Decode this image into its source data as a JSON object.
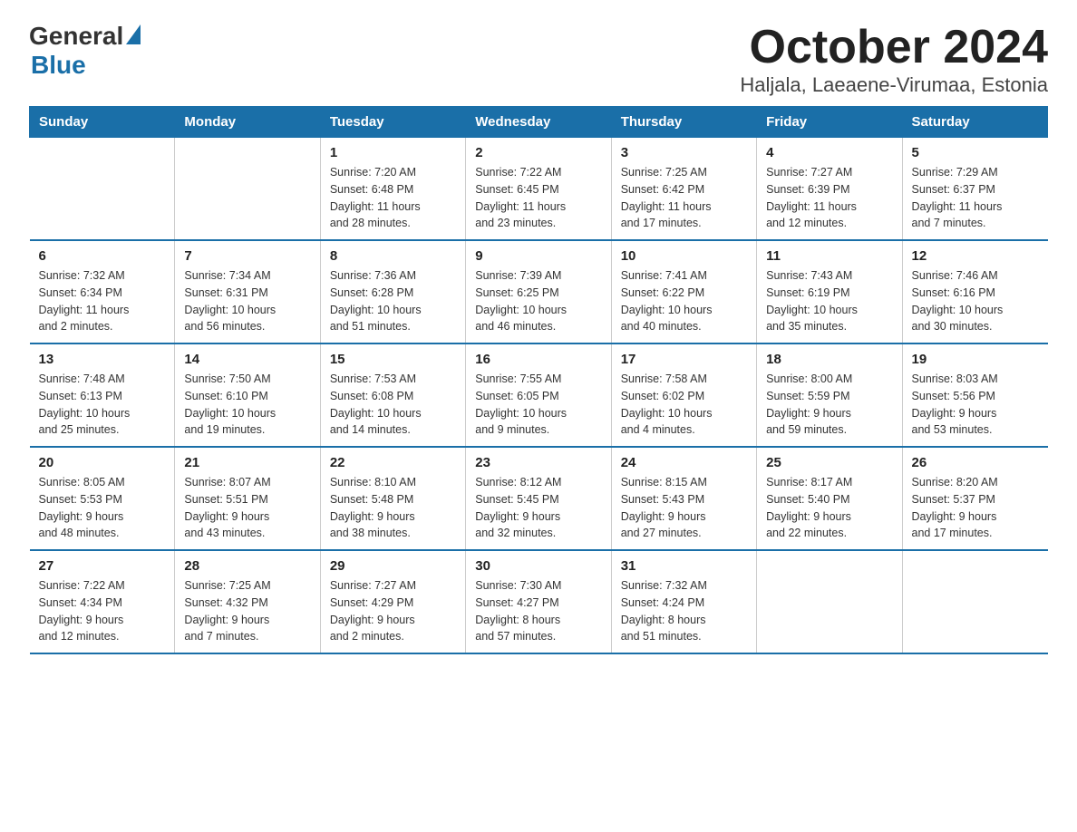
{
  "header": {
    "title": "October 2024",
    "subtitle": "Haljala, Laeaene-Virumaa, Estonia",
    "logo_general": "General",
    "logo_blue": "Blue"
  },
  "weekdays": [
    "Sunday",
    "Monday",
    "Tuesday",
    "Wednesday",
    "Thursday",
    "Friday",
    "Saturday"
  ],
  "weeks": [
    [
      {
        "day": "",
        "info": ""
      },
      {
        "day": "",
        "info": ""
      },
      {
        "day": "1",
        "info": "Sunrise: 7:20 AM\nSunset: 6:48 PM\nDaylight: 11 hours\nand 28 minutes."
      },
      {
        "day": "2",
        "info": "Sunrise: 7:22 AM\nSunset: 6:45 PM\nDaylight: 11 hours\nand 23 minutes."
      },
      {
        "day": "3",
        "info": "Sunrise: 7:25 AM\nSunset: 6:42 PM\nDaylight: 11 hours\nand 17 minutes."
      },
      {
        "day": "4",
        "info": "Sunrise: 7:27 AM\nSunset: 6:39 PM\nDaylight: 11 hours\nand 12 minutes."
      },
      {
        "day": "5",
        "info": "Sunrise: 7:29 AM\nSunset: 6:37 PM\nDaylight: 11 hours\nand 7 minutes."
      }
    ],
    [
      {
        "day": "6",
        "info": "Sunrise: 7:32 AM\nSunset: 6:34 PM\nDaylight: 11 hours\nand 2 minutes."
      },
      {
        "day": "7",
        "info": "Sunrise: 7:34 AM\nSunset: 6:31 PM\nDaylight: 10 hours\nand 56 minutes."
      },
      {
        "day": "8",
        "info": "Sunrise: 7:36 AM\nSunset: 6:28 PM\nDaylight: 10 hours\nand 51 minutes."
      },
      {
        "day": "9",
        "info": "Sunrise: 7:39 AM\nSunset: 6:25 PM\nDaylight: 10 hours\nand 46 minutes."
      },
      {
        "day": "10",
        "info": "Sunrise: 7:41 AM\nSunset: 6:22 PM\nDaylight: 10 hours\nand 40 minutes."
      },
      {
        "day": "11",
        "info": "Sunrise: 7:43 AM\nSunset: 6:19 PM\nDaylight: 10 hours\nand 35 minutes."
      },
      {
        "day": "12",
        "info": "Sunrise: 7:46 AM\nSunset: 6:16 PM\nDaylight: 10 hours\nand 30 minutes."
      }
    ],
    [
      {
        "day": "13",
        "info": "Sunrise: 7:48 AM\nSunset: 6:13 PM\nDaylight: 10 hours\nand 25 minutes."
      },
      {
        "day": "14",
        "info": "Sunrise: 7:50 AM\nSunset: 6:10 PM\nDaylight: 10 hours\nand 19 minutes."
      },
      {
        "day": "15",
        "info": "Sunrise: 7:53 AM\nSunset: 6:08 PM\nDaylight: 10 hours\nand 14 minutes."
      },
      {
        "day": "16",
        "info": "Sunrise: 7:55 AM\nSunset: 6:05 PM\nDaylight: 10 hours\nand 9 minutes."
      },
      {
        "day": "17",
        "info": "Sunrise: 7:58 AM\nSunset: 6:02 PM\nDaylight: 10 hours\nand 4 minutes."
      },
      {
        "day": "18",
        "info": "Sunrise: 8:00 AM\nSunset: 5:59 PM\nDaylight: 9 hours\nand 59 minutes."
      },
      {
        "day": "19",
        "info": "Sunrise: 8:03 AM\nSunset: 5:56 PM\nDaylight: 9 hours\nand 53 minutes."
      }
    ],
    [
      {
        "day": "20",
        "info": "Sunrise: 8:05 AM\nSunset: 5:53 PM\nDaylight: 9 hours\nand 48 minutes."
      },
      {
        "day": "21",
        "info": "Sunrise: 8:07 AM\nSunset: 5:51 PM\nDaylight: 9 hours\nand 43 minutes."
      },
      {
        "day": "22",
        "info": "Sunrise: 8:10 AM\nSunset: 5:48 PM\nDaylight: 9 hours\nand 38 minutes."
      },
      {
        "day": "23",
        "info": "Sunrise: 8:12 AM\nSunset: 5:45 PM\nDaylight: 9 hours\nand 32 minutes."
      },
      {
        "day": "24",
        "info": "Sunrise: 8:15 AM\nSunset: 5:43 PM\nDaylight: 9 hours\nand 27 minutes."
      },
      {
        "day": "25",
        "info": "Sunrise: 8:17 AM\nSunset: 5:40 PM\nDaylight: 9 hours\nand 22 minutes."
      },
      {
        "day": "26",
        "info": "Sunrise: 8:20 AM\nSunset: 5:37 PM\nDaylight: 9 hours\nand 17 minutes."
      }
    ],
    [
      {
        "day": "27",
        "info": "Sunrise: 7:22 AM\nSunset: 4:34 PM\nDaylight: 9 hours\nand 12 minutes."
      },
      {
        "day": "28",
        "info": "Sunrise: 7:25 AM\nSunset: 4:32 PM\nDaylight: 9 hours\nand 7 minutes."
      },
      {
        "day": "29",
        "info": "Sunrise: 7:27 AM\nSunset: 4:29 PM\nDaylight: 9 hours\nand 2 minutes."
      },
      {
        "day": "30",
        "info": "Sunrise: 7:30 AM\nSunset: 4:27 PM\nDaylight: 8 hours\nand 57 minutes."
      },
      {
        "day": "31",
        "info": "Sunrise: 7:32 AM\nSunset: 4:24 PM\nDaylight: 8 hours\nand 51 minutes."
      },
      {
        "day": "",
        "info": ""
      },
      {
        "day": "",
        "info": ""
      }
    ]
  ]
}
